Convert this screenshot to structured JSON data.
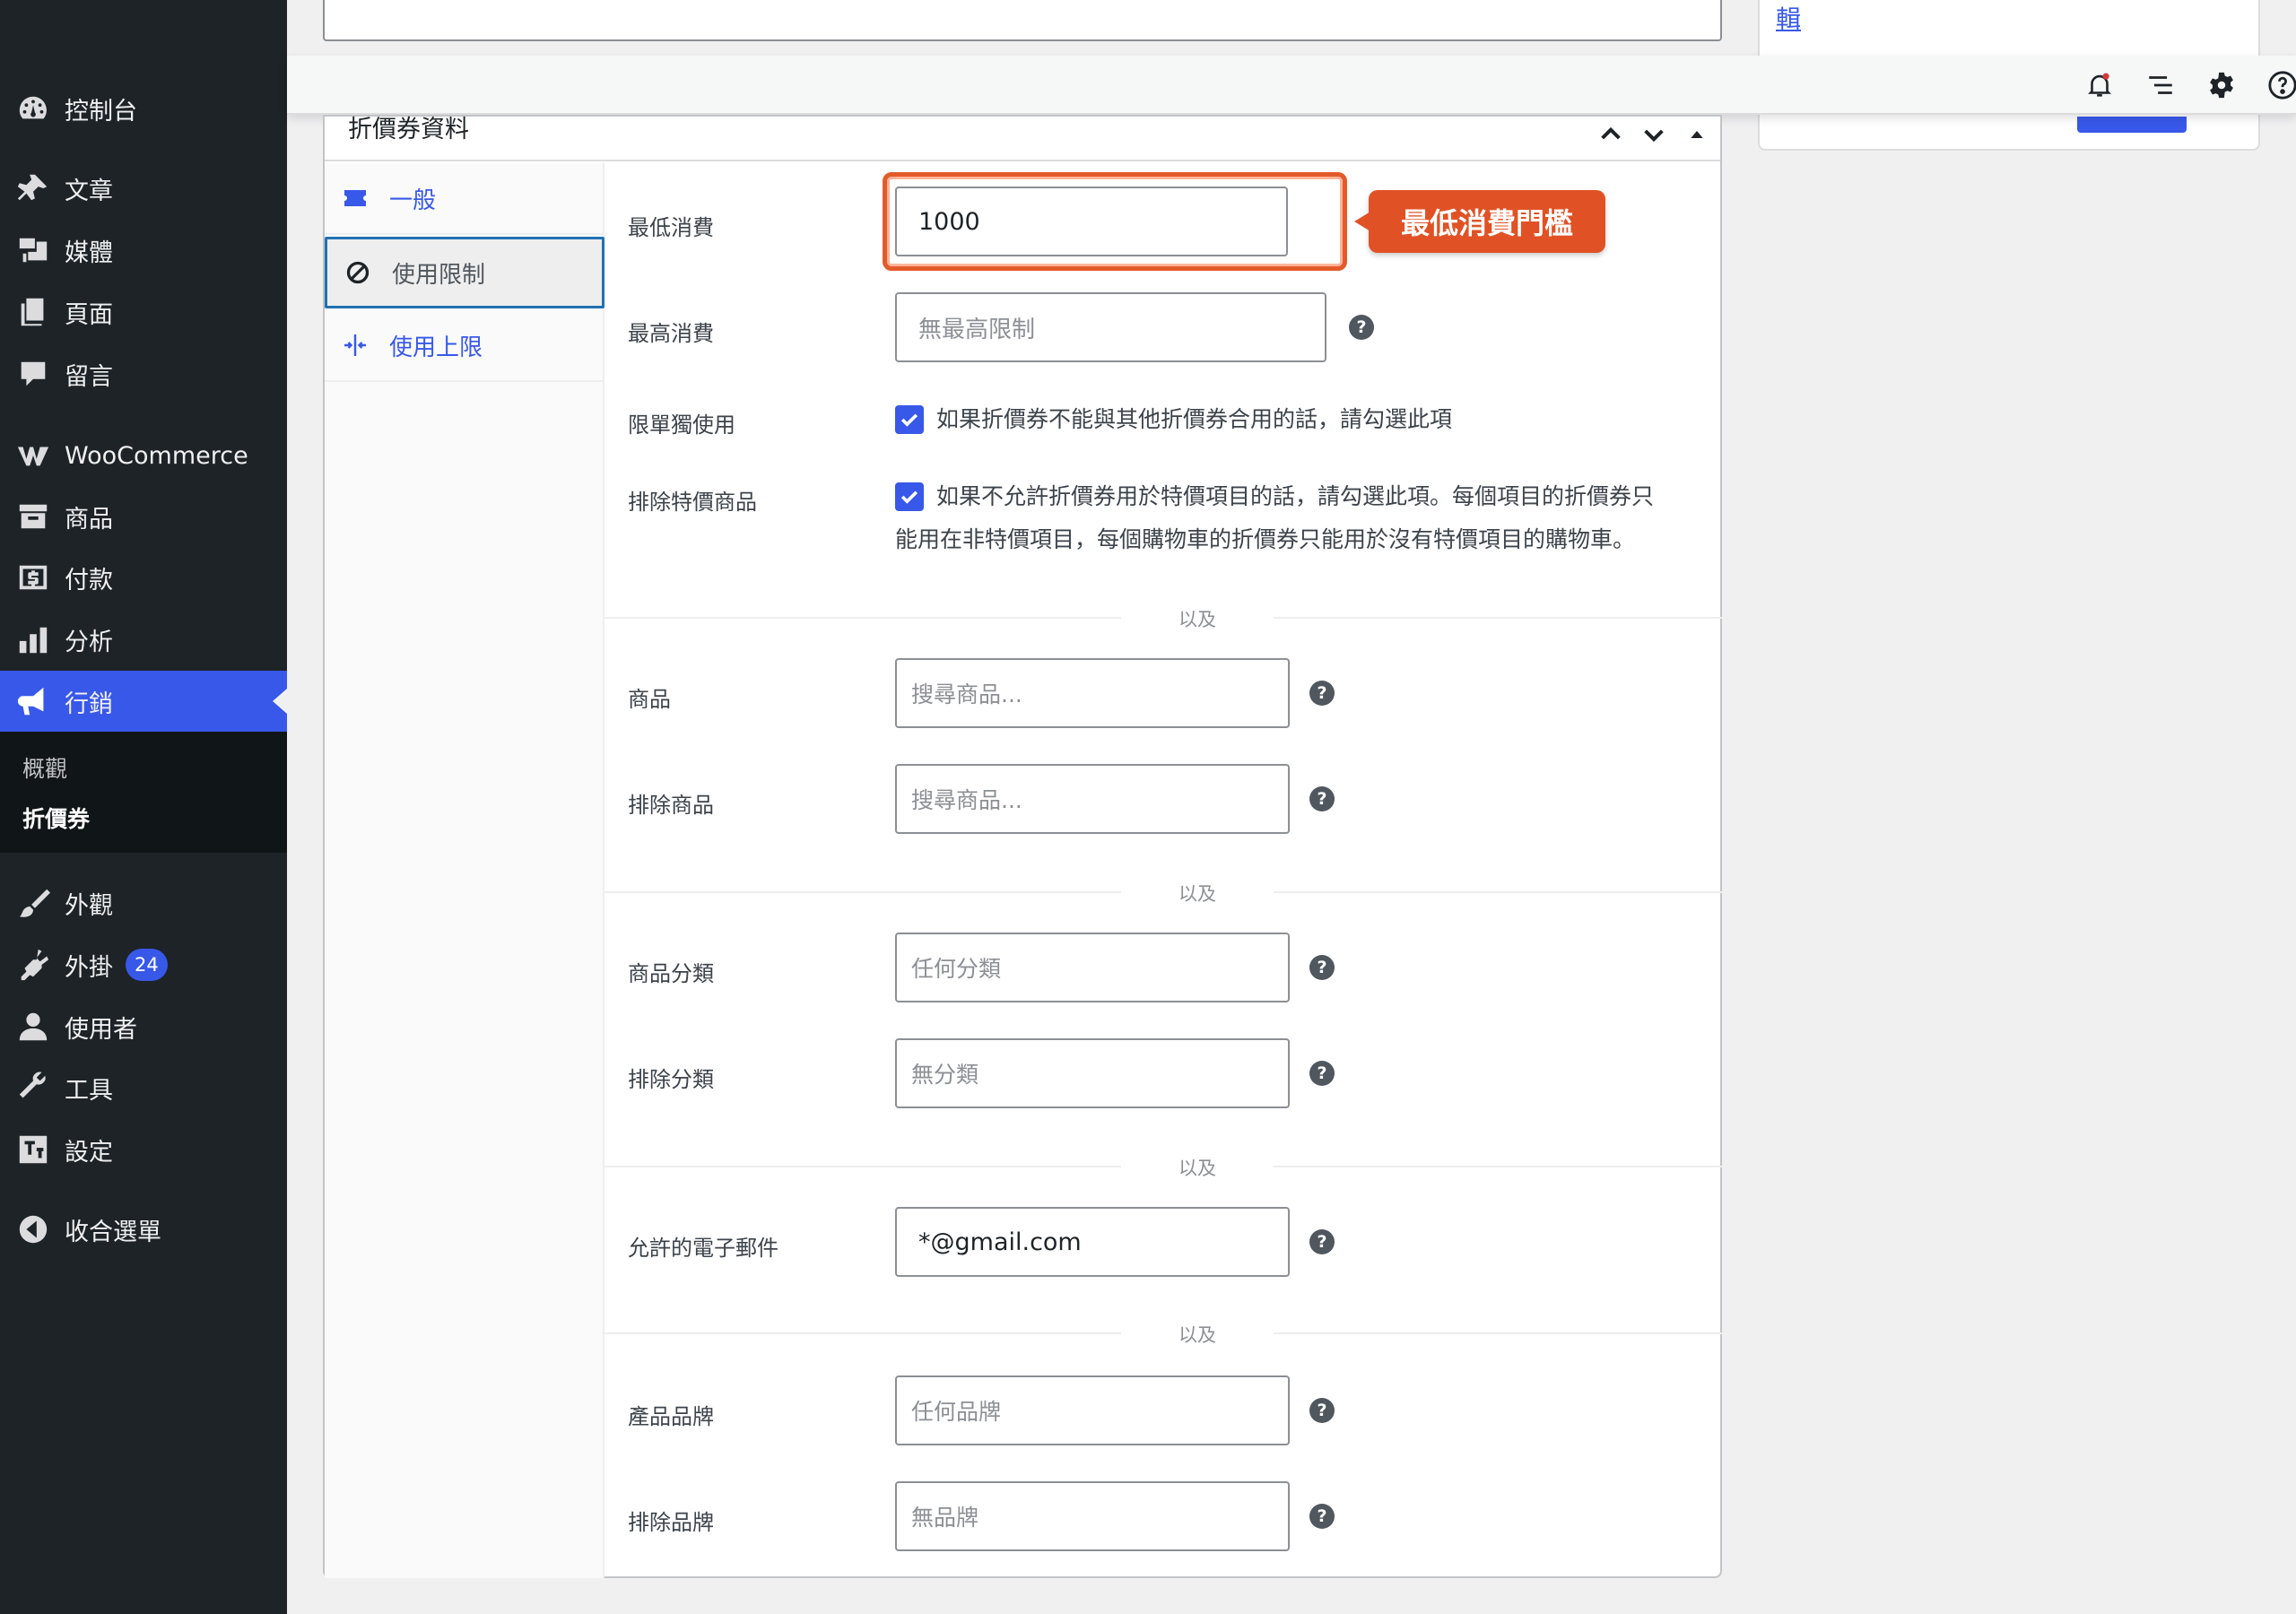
{
  "sidebar": {
    "items": [
      {
        "label": "控制台",
        "icon": "dashboard-icon"
      },
      {
        "label": "文章",
        "icon": "pin-icon"
      },
      {
        "label": "媒體",
        "icon": "media-icon"
      },
      {
        "label": "頁面",
        "icon": "pages-icon"
      },
      {
        "label": "留言",
        "icon": "comment-icon"
      },
      {
        "label": "WooCommerce",
        "icon": "woocommerce-icon"
      },
      {
        "label": "商品",
        "icon": "archive-icon"
      },
      {
        "label": "付款",
        "icon": "payment-icon"
      },
      {
        "label": "分析",
        "icon": "analytics-icon"
      },
      {
        "label": "行銷",
        "icon": "megaphone-icon"
      },
      {
        "label": "外觀",
        "icon": "brush-icon"
      },
      {
        "label": "外掛",
        "icon": "plugin-icon"
      },
      {
        "label": "使用者",
        "icon": "user-icon"
      },
      {
        "label": "工具",
        "icon": "wrench-icon"
      },
      {
        "label": "設定",
        "icon": "settings-icon"
      },
      {
        "label": "收合選單",
        "icon": "collapse-icon"
      }
    ],
    "submenu": [
      "概觀",
      "折價券"
    ],
    "plugin_badge": "24"
  },
  "top": {
    "right_link": "輯"
  },
  "panel": {
    "title": "折價券資料",
    "tabs": [
      "一般",
      "使用限制",
      "使用上限"
    ],
    "fields": {
      "min_spend": {
        "label": "最低消費",
        "value": "1000"
      },
      "max_spend": {
        "label": "最高消費",
        "placeholder": "無最高限制"
      },
      "individual_use": {
        "label": "限單獨使用",
        "text": "如果折價券不能與其他折價券合用的話，請勾選此項"
      },
      "exclude_sale": {
        "label": "排除特價商品",
        "text_line1": "如果不允許折價券用於特價項目的話，請勾選此項。每個項目的折價券只",
        "text_line2": "能用在非特價項目，每個購物車的折價券只能用於沒有特價項目的購物車。"
      },
      "products": {
        "label": "商品",
        "placeholder": "搜尋商品..."
      },
      "exclude_products": {
        "label": "排除商品",
        "placeholder": "搜尋商品..."
      },
      "categories": {
        "label": "商品分類",
        "placeholder": "任何分類"
      },
      "exclude_categories": {
        "label": "排除分類",
        "placeholder": "無分類"
      },
      "emails": {
        "label": "允許的電子郵件",
        "value": "*@gmail.com"
      },
      "brands": {
        "label": "產品品牌",
        "placeholder": "任何品牌"
      },
      "exclude_brands": {
        "label": "排除品牌",
        "placeholder": "無品牌"
      }
    },
    "and_label": "以及",
    "callout": "最低消費門檻"
  },
  "colors": {
    "accent": "#3858e9",
    "sidebar": "#1d2327",
    "callout": "#e05225"
  }
}
